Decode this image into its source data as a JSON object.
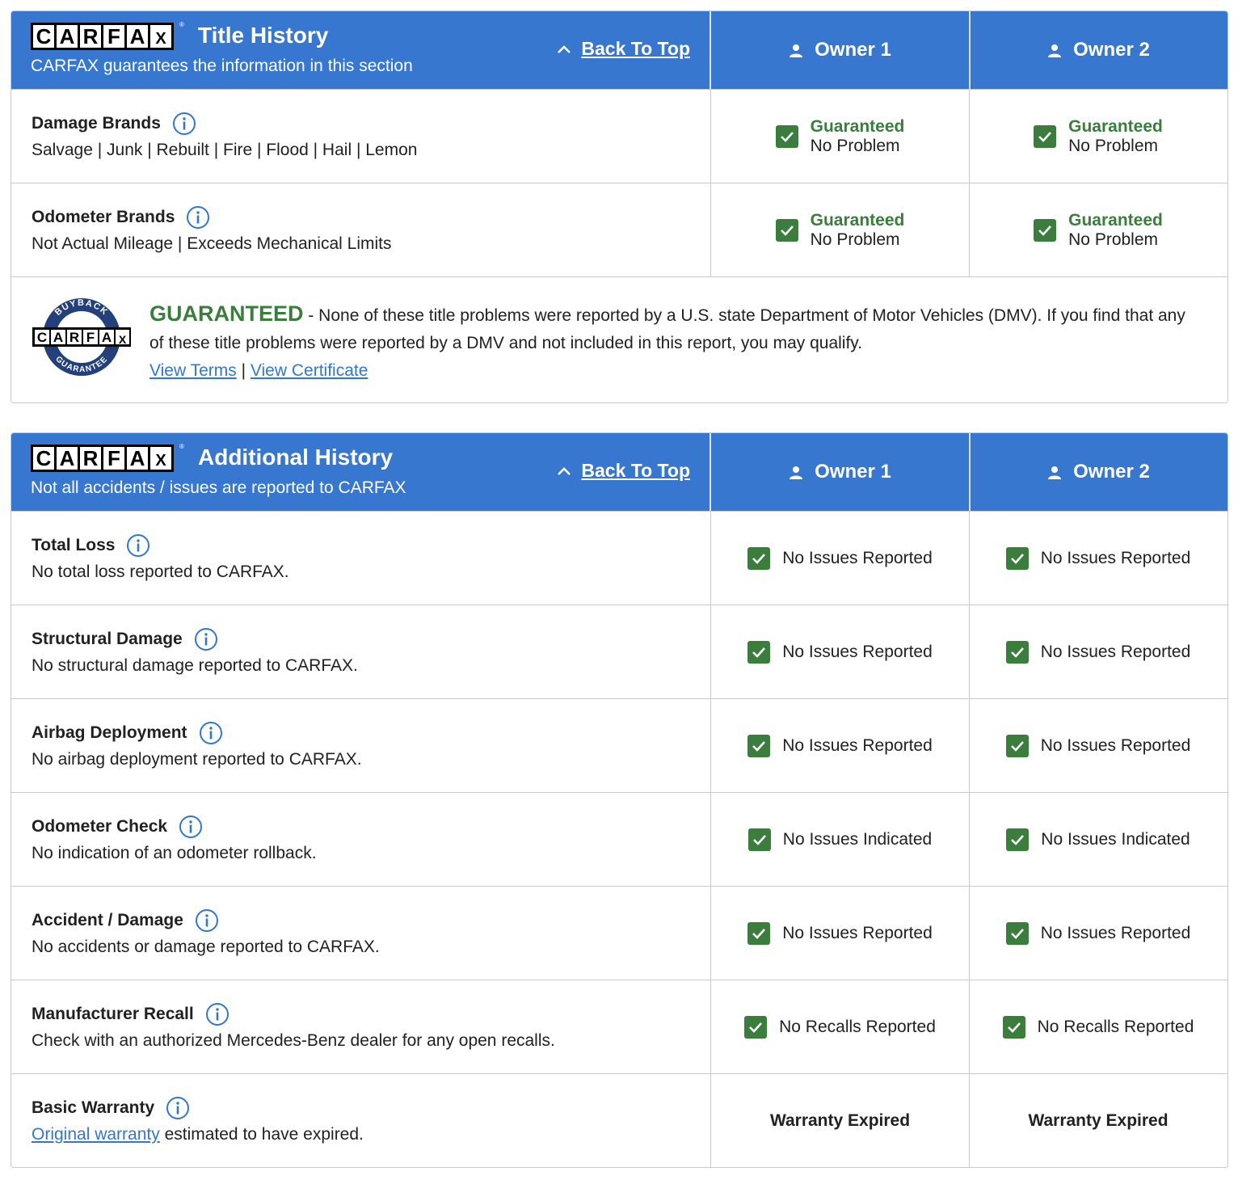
{
  "brand": {
    "logo_letters": [
      "C",
      "A",
      "R",
      "F",
      "A",
      "X"
    ],
    "reg_mark": "®"
  },
  "colors": {
    "header_blue": "#3777cf",
    "check_green": "#3a7d3c",
    "link_blue": "#3377cc"
  },
  "title_history": {
    "title": "Title History",
    "subtitle": "CARFAX guarantees the information in this section",
    "back_to_top": "Back To Top",
    "owners": [
      "Owner 1",
      "Owner 2"
    ],
    "rows": [
      {
        "label": "Damage Brands",
        "desc": "Salvage | Junk | Rebuilt | Fire | Flood | Hail | Lemon",
        "owner1": {
          "guaranteed": "Guaranteed",
          "status": "No Problem"
        },
        "owner2": {
          "guaranteed": "Guaranteed",
          "status": "No Problem"
        }
      },
      {
        "label": "Odometer Brands",
        "desc": "Not Actual Mileage | Exceeds Mechanical Limits",
        "owner1": {
          "guaranteed": "Guaranteed",
          "status": "No Problem"
        },
        "owner2": {
          "guaranteed": "Guaranteed",
          "status": "No Problem"
        }
      }
    ],
    "guarantee": {
      "seal_top": "BUYBACK",
      "seal_bottom": "GUARANTEE",
      "headline": "GUARANTEED",
      "text": " - None of these title problems were reported by a U.S. state Department of Motor Vehicles (DMV). If you find that any of these title problems were reported by a DMV and not included in this report, you may qualify.",
      "view_terms": "View Terms",
      "separator": " | ",
      "view_certificate": "View Certificate"
    }
  },
  "additional_history": {
    "title": "Additional History",
    "subtitle": "Not all accidents / issues are reported to CARFAX",
    "back_to_top": "Back To Top",
    "owners": [
      "Owner 1",
      "Owner 2"
    ],
    "rows": [
      {
        "label": "Total Loss",
        "desc": "No total loss reported to CARFAX.",
        "owner1": "No Issues Reported",
        "owner2": "No Issues Reported"
      },
      {
        "label": "Structural Damage",
        "desc": "No structural damage reported to CARFAX.",
        "owner1": "No Issues Reported",
        "owner2": "No Issues Reported"
      },
      {
        "label": "Airbag Deployment",
        "desc": "No airbag deployment reported to CARFAX.",
        "owner1": "No Issues Reported",
        "owner2": "No Issues Reported"
      },
      {
        "label": "Odometer Check",
        "desc": "No indication of an odometer rollback.",
        "owner1": "No Issues Indicated",
        "owner2": "No Issues Indicated"
      },
      {
        "label": "Accident / Damage",
        "desc": "No accidents or damage reported to CARFAX.",
        "owner1": "No Issues Reported",
        "owner2": "No Issues Reported"
      },
      {
        "label": "Manufacturer Recall",
        "desc": "Check with an authorized Mercedes-Benz dealer for any open recalls.",
        "owner1": "No Recalls Reported",
        "owner2": "No Recalls Reported"
      }
    ],
    "warranty": {
      "label": "Basic Warranty",
      "link": "Original warranty",
      "desc": " estimated to have expired.",
      "owner1": "Warranty Expired",
      "owner2": "Warranty Expired"
    }
  }
}
